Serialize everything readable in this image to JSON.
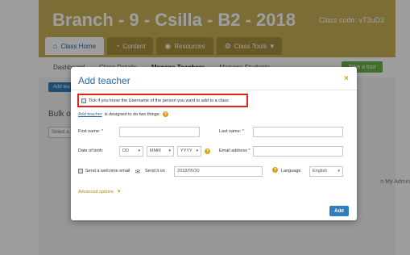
{
  "header": {
    "course_title": "Branch - 9 - Csilla - B2 - 2018",
    "class_code": "Class code: vT3uD3"
  },
  "tabs": [
    {
      "label": "Class Home",
      "icon": "home-icon"
    },
    {
      "label": "Content",
      "icon": "content-icon"
    },
    {
      "label": "Resources",
      "icon": "resources-icon"
    },
    {
      "label": "Class Tools",
      "icon": "tools-icon"
    }
  ],
  "subnav": {
    "items": [
      "Dashboard",
      "Class Details",
      "Manage Teachers",
      "Manage Students"
    ],
    "tour_label": "Take a tour"
  },
  "background": {
    "add_teacher_label": "Add tea",
    "bulk_title": "Bulk opti",
    "bulk_select": "Select a t",
    "my_admin": "n My Admin"
  },
  "modal": {
    "title": "Add teacher",
    "close": "×",
    "hint": "Tick if you know the Username of the person you want to add to a class",
    "designed_link": "Add teacher",
    "designed_rest": "is designed to do two things:",
    "first_name_label": "First name:",
    "last_name_label": "Last name:",
    "dob_label": "Date of birth:",
    "dob_day": "DD",
    "dob_month": "MMM",
    "dob_year": "YYYY",
    "email_label": "Email address",
    "welcome_label": "Send a welcome email",
    "send_on_label": "Send it on",
    "send_date": "2018/05/30",
    "language_label": "Language",
    "language_value": "English",
    "advanced_label": "Advanced options",
    "add_button": "Add"
  },
  "colors": {
    "banner": "#c9b15a",
    "accent_blue": "#2e7dc0",
    "highlight_red": "#e2231a",
    "help_gold": "#d4a017"
  }
}
